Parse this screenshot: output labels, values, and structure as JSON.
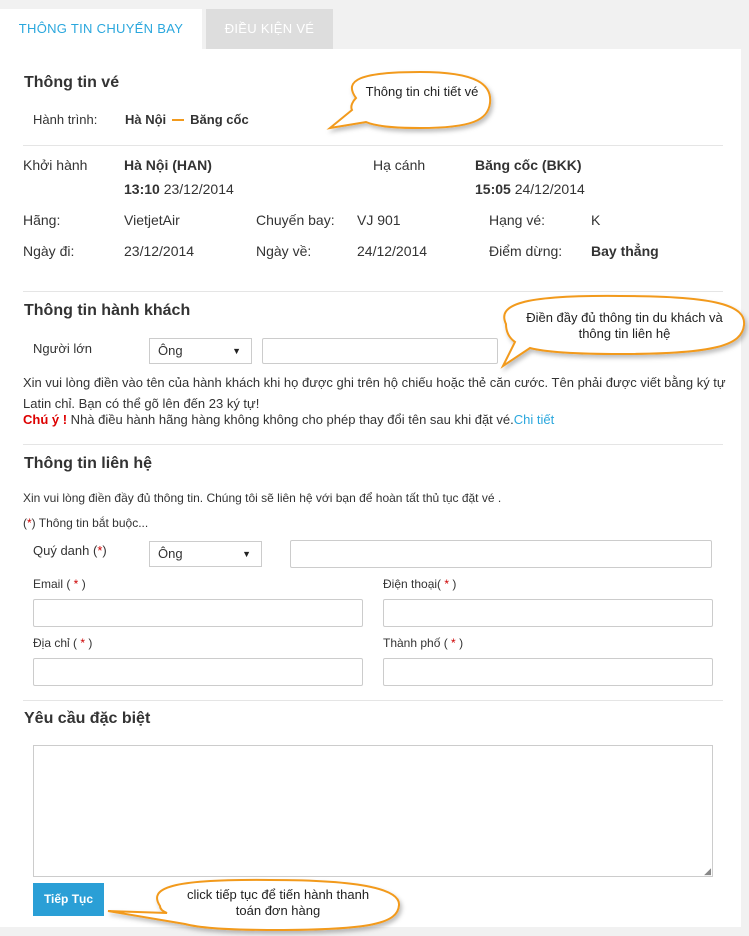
{
  "tabs": {
    "flight_info": "THÔNG TIN CHUYẾN BAY",
    "ticket_conditions": "ĐIỀU KIỆN VÉ"
  },
  "ticket": {
    "heading": "Thông tin vé",
    "route_label": "Hành trình:",
    "route_from": "Hà Nội",
    "route_to": "Băng cốc"
  },
  "flight": {
    "depart_label": "Khởi hành",
    "depart_city": "Hà Nội (HAN)",
    "depart_time": "13:10",
    "depart_date": "23/12/2014",
    "arrive_label": "Hạ cánh",
    "arrive_city": "Băng cốc (BKK)",
    "arrive_time": "15:05",
    "arrive_date": "24/12/2014",
    "airline_label": "Hãng:",
    "airline": "VietjetAir",
    "flight_no_label": "Chuyến bay:",
    "flight_no": "VJ 901",
    "class_label": "Hạng vé:",
    "class": "K",
    "go_date_label": "Ngày đi:",
    "go_date": "23/12/2014",
    "return_date_label": "Ngày về:",
    "return_date": "24/12/2014",
    "stop_label": "Điểm dừng:",
    "stop": "Bay thẳng"
  },
  "passenger": {
    "heading": "Thông tin hành khách",
    "adult_label": "Người lớn",
    "title_value": "Ông",
    "name_value": "",
    "note": "Xin vui lòng điền vào tên của hành khách khi họ được ghi trên hộ chiếu hoặc thẻ căn cước. Tên phải được viết bằng ký tự Latin chỉ. Bạn có thể gõ lên đến 23 ký tự!",
    "warning_label": "Chú ý !",
    "warning_text": " Nhà điều hành hãng hàng không không cho phép thay đổi tên sau khi đặt vé.",
    "detail_link": "Chi tiết"
  },
  "contact": {
    "heading": "Thông tin liên hệ",
    "intro": "Xin vui lòng điền đầy đủ thông tin. Chúng tôi sẽ liên hệ với bạn để hoàn tất thủ tục đặt vé .",
    "required_note_prefix": "(",
    "required_star": "*",
    "required_note_suffix": ") Thông tin bắt buộc...",
    "salutation_label": "Quý danh (",
    "salutation_close": ")",
    "salutation_value": "Ông",
    "email_label": "Email (",
    "email_close": ")",
    "phone_label": "Điện thoại(",
    "phone_close": ")",
    "address_label": "Địa chỉ (",
    "address_close": ")",
    "city_label": "Thành phố (",
    "city_close": ")",
    "star": " * "
  },
  "special": {
    "heading": "Yêu cầu đặc biệt",
    "value": ""
  },
  "continue_button": "Tiếp Tục",
  "callouts": {
    "ticket_detail": "Thông tin chi tiết vé",
    "fill_info": "Điền đầy đủ thông tin du khách và thông tin liên hệ",
    "click_continue": "click tiếp tục để tiến hành thanh toán đơn hàng"
  },
  "colors": {
    "accent": "#2aa7dd",
    "button": "#2a9fd6",
    "callout_border": "#f29a1d",
    "required": "#cc0000"
  }
}
